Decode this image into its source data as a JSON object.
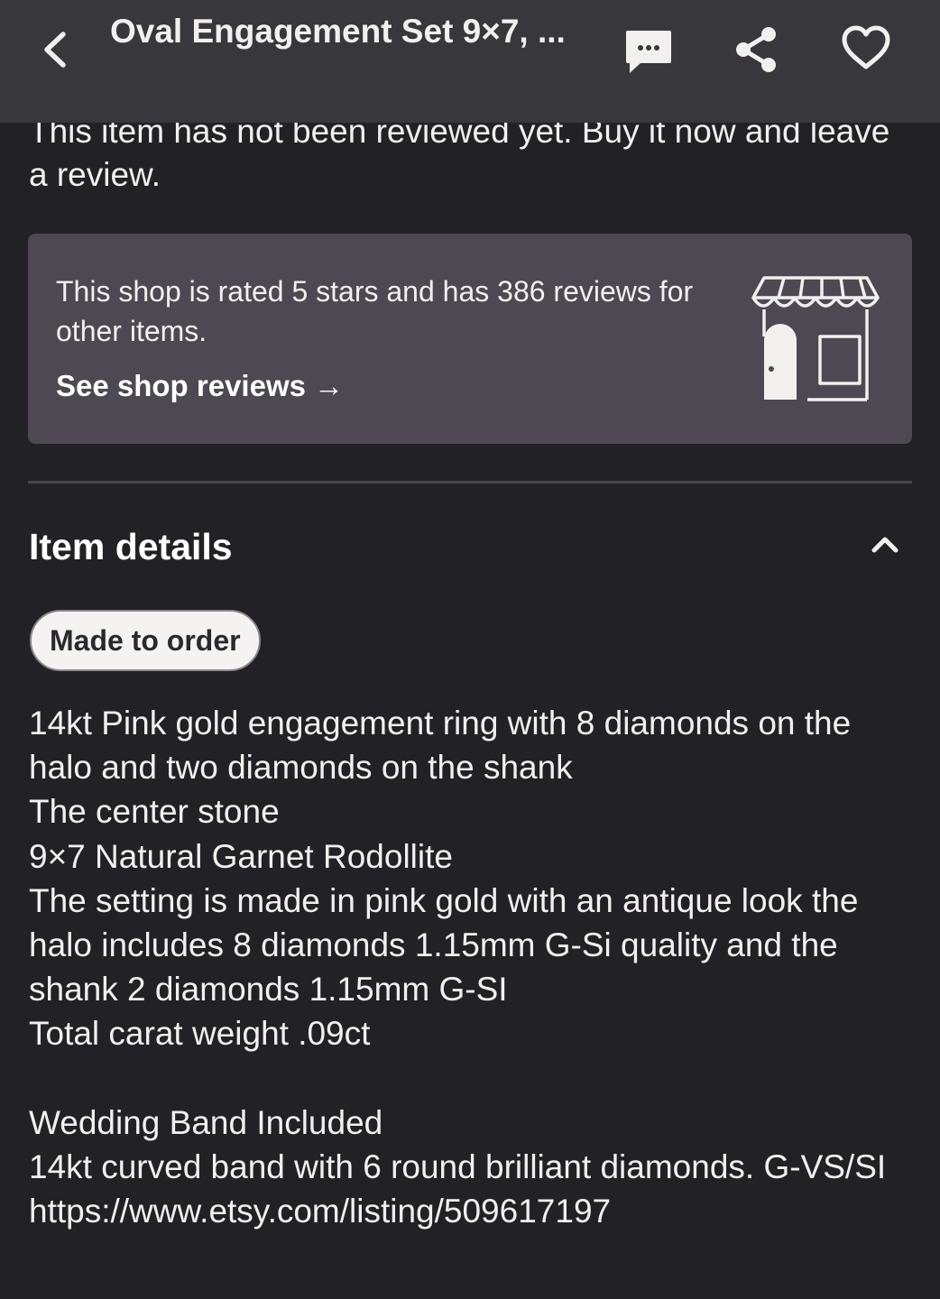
{
  "header": {
    "title": "Oval Engagement Set  9×7, ...",
    "back_icon": "chevron-left-icon",
    "icons": [
      "message-icon",
      "share-icon",
      "heart-icon"
    ]
  },
  "reviews": {
    "note": "This item has not been reviewed yet. Buy it now and leave a review.",
    "shop_rating_text": "This shop is rated 5 stars and has 386 reviews for other items.",
    "shop_reviews_link": "See shop reviews →"
  },
  "item_details": {
    "title": "Item details",
    "badge": "Made to order",
    "description_lines": [
      "14kt Pink gold engagement ring with 8 diamonds on the halo and two diamonds on the shank",
      "The center stone",
      "9×7 Natural Garnet Rodollite",
      "The setting is made in pink gold with an antique look the halo includes 8 diamonds 1.15mm G-Si quality and the shank 2 diamonds 1.15mm G-SI",
      "Total carat weight .09ct",
      "",
      "Wedding Band Included",
      "14kt curved band with 6 round brilliant diamonds. G-VS/SI",
      "https://www.etsy.com/listing/509617197"
    ]
  },
  "colors": {
    "background": "#222126",
    "header": "#38373c",
    "card": "#4d4852",
    "text": "#f2f0ee",
    "badge_bg": "#f5f3f1"
  }
}
